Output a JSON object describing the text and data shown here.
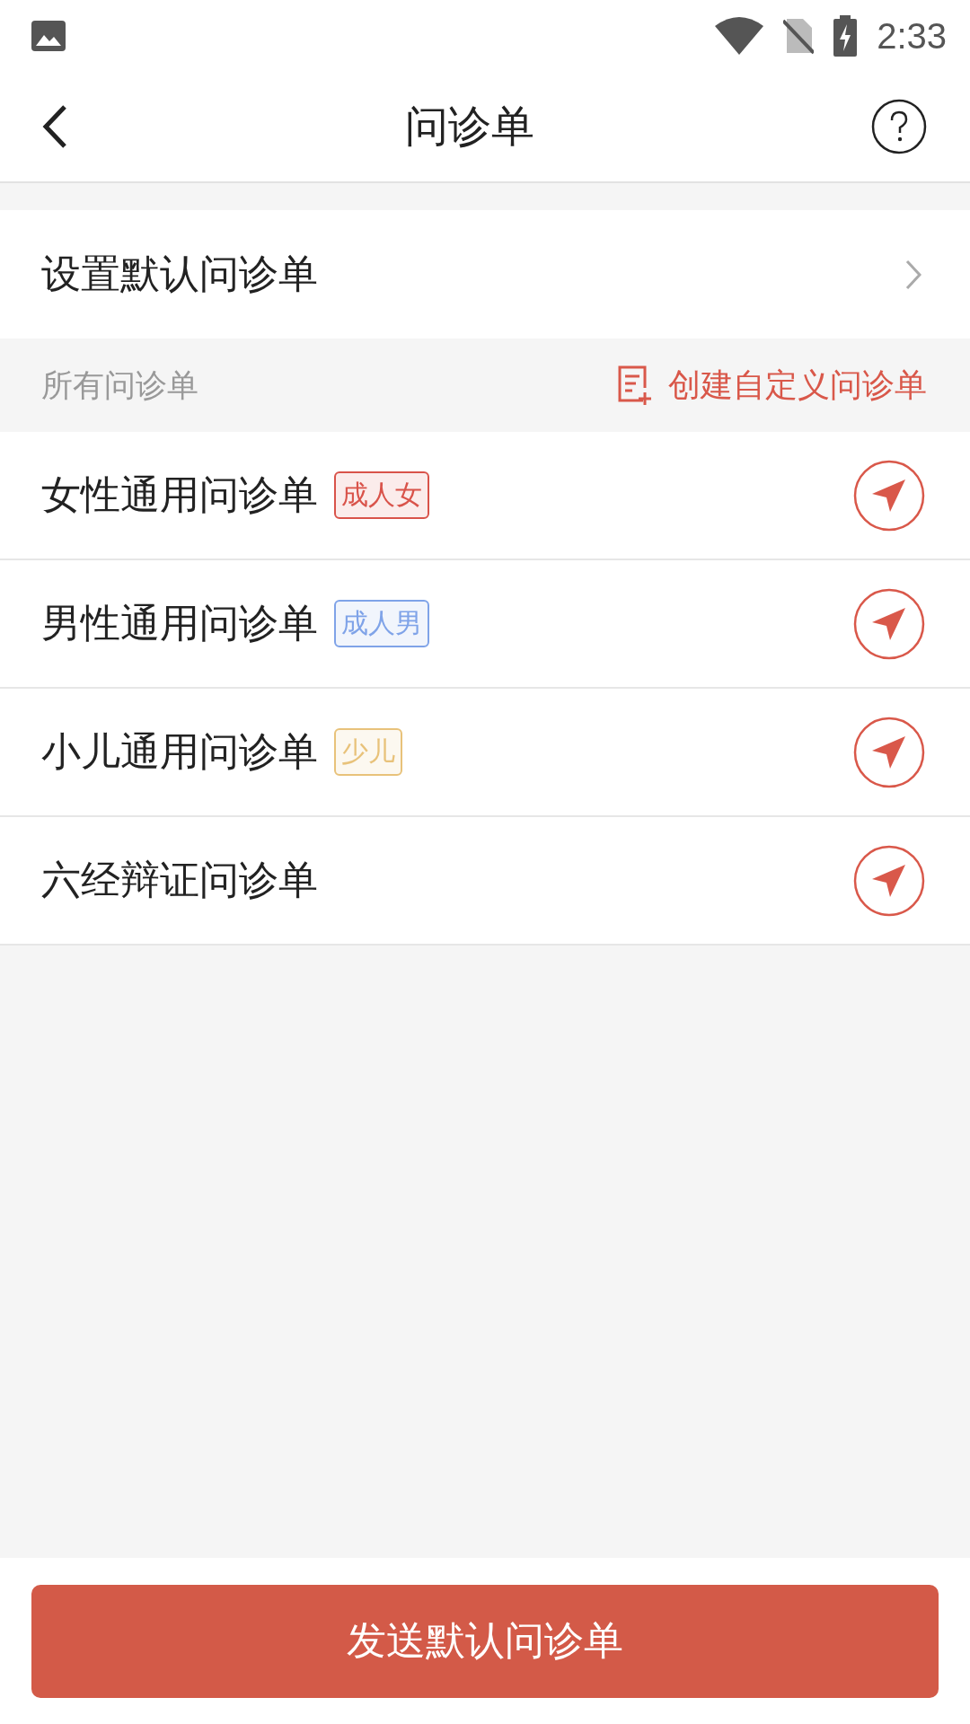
{
  "status_bar": {
    "time": "2:33"
  },
  "header": {
    "title": "问诊单"
  },
  "default_row": {
    "label": "设置默认问诊单"
  },
  "section": {
    "title": "所有问诊单",
    "action": "创建自定义问诊单"
  },
  "forms": [
    {
      "name": "女性通用问诊单",
      "tag": {
        "label": "成人女",
        "color": "#d9534a"
      }
    },
    {
      "name": "男性通用问诊单",
      "tag": {
        "label": "成人男",
        "color": "#7fa3e8"
      }
    },
    {
      "name": "小儿通用问诊单",
      "tag": {
        "label": "少儿",
        "color": "#e8c27a"
      }
    },
    {
      "name": "六经辩证问诊单"
    }
  ],
  "bottom_button": {
    "label": "发送默认问诊单"
  }
}
